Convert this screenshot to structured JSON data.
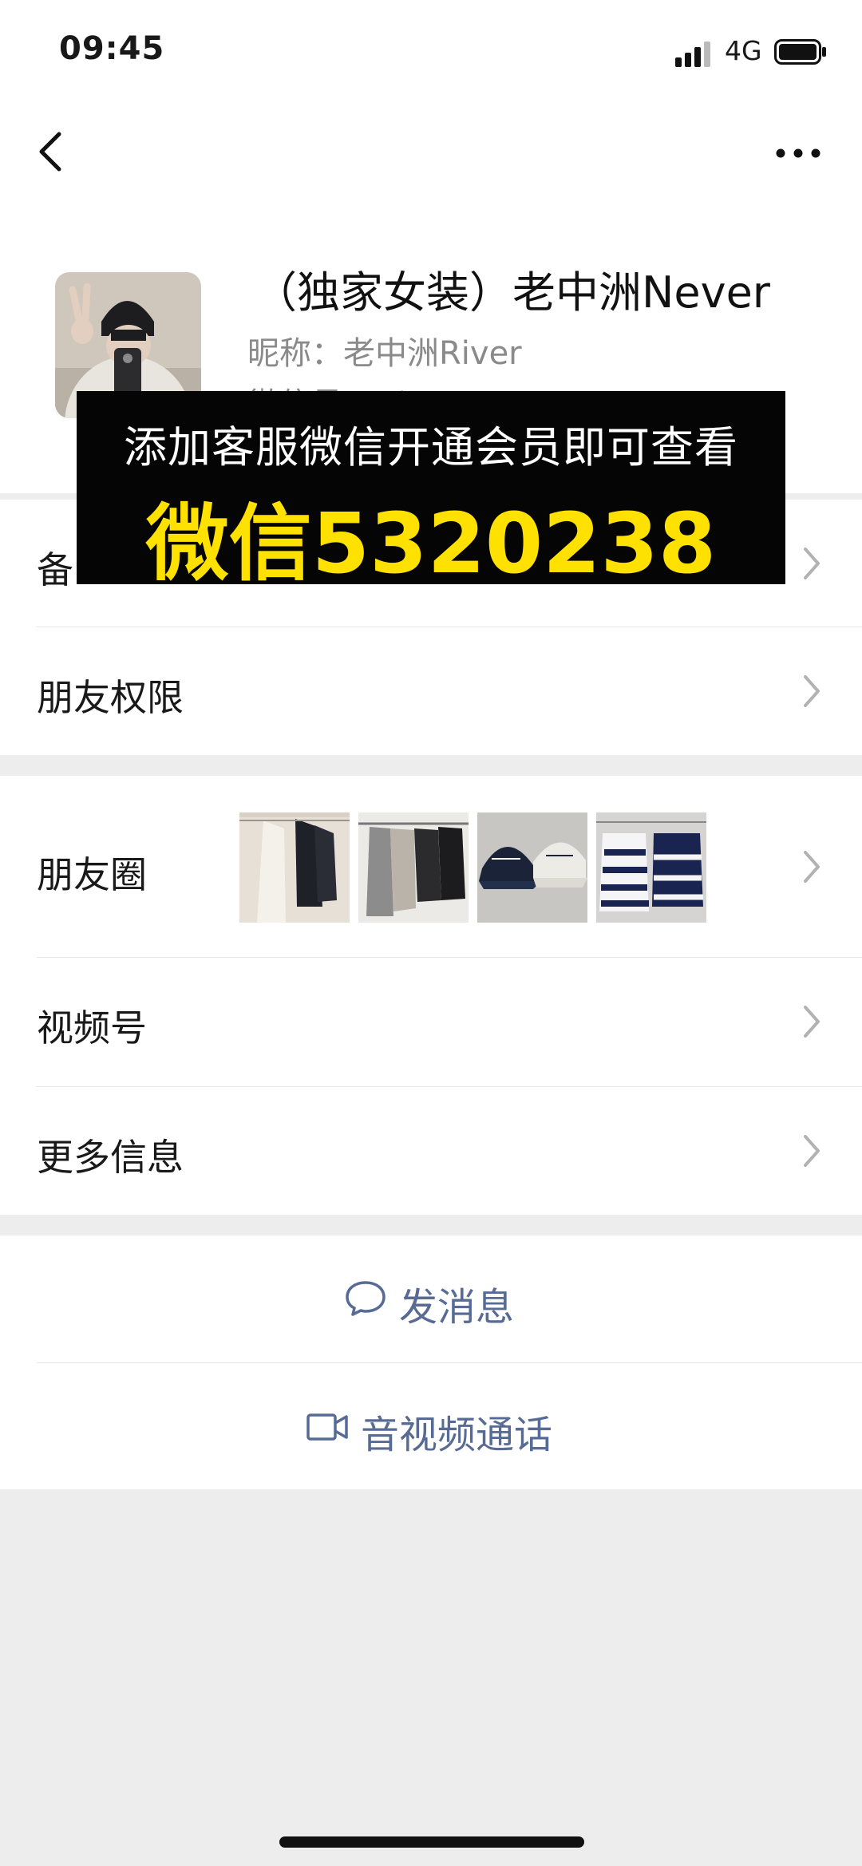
{
  "status_bar": {
    "time": "09:45",
    "network": "4G"
  },
  "profile": {
    "display_name": "（独家女装）老中洲Never",
    "nickname_line": "昵称：老中洲River",
    "wechat_id_line": "微信号：River33301"
  },
  "overlay": {
    "line1": "添加客服微信开通会员即可查看",
    "line2": "微信5320238"
  },
  "rows": {
    "remark": "备",
    "friend_permissions": "朋友权限",
    "moments": "朋友圈",
    "channels": "视频号",
    "more_info": "更多信息"
  },
  "actions": {
    "send_message": "发消息",
    "video_call": "音视频通话"
  },
  "colors": {
    "link": "#576b95",
    "banner_bg": "#050505",
    "banner_highlight": "#ffe100",
    "page_bg": "#ededed"
  },
  "icons": [
    "back-icon",
    "more-icon",
    "chevron-right-icon",
    "message-bubble-icon",
    "video-camera-icon"
  ]
}
